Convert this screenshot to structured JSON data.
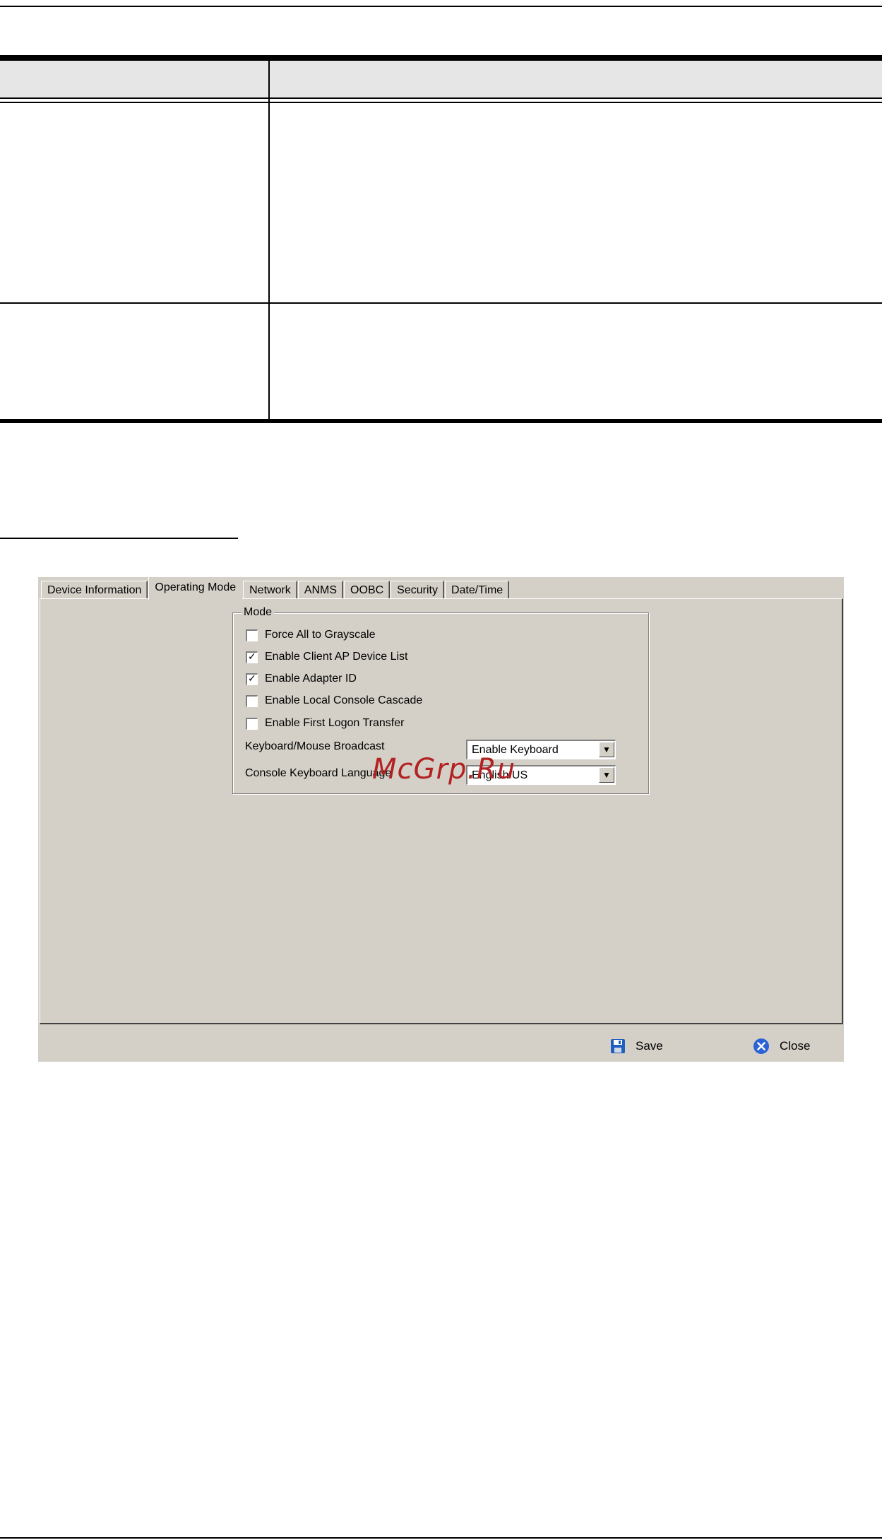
{
  "dialog": {
    "tabs": [
      {
        "label": "Device Information",
        "active": false
      },
      {
        "label": "Operating Mode",
        "active": true
      },
      {
        "label": "Network",
        "active": false
      },
      {
        "label": "ANMS",
        "active": false
      },
      {
        "label": "OOBC",
        "active": false
      },
      {
        "label": "Security",
        "active": false
      },
      {
        "label": "Date/Time",
        "active": false
      }
    ],
    "mode": {
      "legend": "Mode",
      "checkboxes": [
        {
          "label": "Force All to Grayscale",
          "checked": false
        },
        {
          "label": "Enable Client AP Device List",
          "checked": true
        },
        {
          "label": "Enable Adapter ID",
          "checked": true
        },
        {
          "label": "Enable Local Console Cascade",
          "checked": false
        },
        {
          "label": "Enable First Logon Transfer",
          "checked": false
        }
      ],
      "broadcast_label": "Keyboard/Mouse Broadcast",
      "broadcast_value": "Enable Keyboard",
      "language_label": "Console Keyboard Language",
      "language_value": "English US"
    },
    "footer": {
      "save_label": "Save",
      "close_label": "Close"
    },
    "colors": {
      "window_bg": "#d4d0c8",
      "save_icon": "#1f5fbf",
      "close_icon": "#2a63d6"
    }
  },
  "watermark": "McGrp.Ru"
}
